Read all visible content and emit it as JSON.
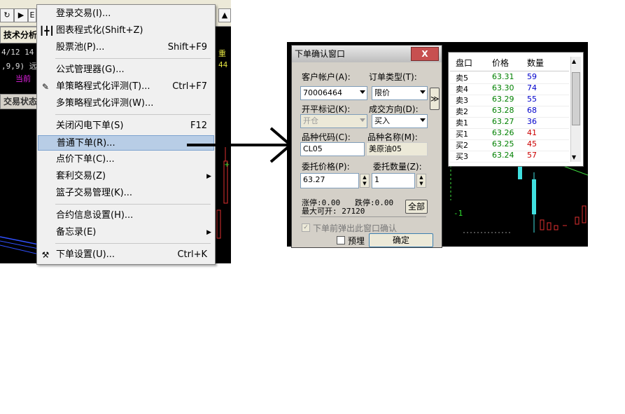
{
  "left": {
    "tab_label": "技术分析",
    "line1": "4/12 14",
    "line2": ",9,9) 远",
    "line3": "当前",
    "trade_tab": "交易状态",
    "right_text1": "重",
    "right_text2": "44"
  },
  "menu": {
    "items": [
      {
        "label": "登录交易(I)...",
        "shortcut": "",
        "icon": ""
      },
      {
        "label": "图表程式化(Shift+Z)",
        "shortcut": "",
        "icon": "candlestick"
      },
      {
        "label": "股票池(P)...",
        "shortcut": "Shift+F9",
        "icon": ""
      },
      {
        "label": "公式管理器(G)...",
        "shortcut": "",
        "icon": ""
      },
      {
        "label": "单策略程式化评测(T)...",
        "shortcut": "Ctrl+F7",
        "icon": "edit"
      },
      {
        "label": "多策略程式化评测(W)...",
        "shortcut": "",
        "icon": ""
      },
      {
        "label": "关闭闪电下单(S)",
        "shortcut": "F12",
        "icon": ""
      },
      {
        "label": "普通下单(R)...",
        "shortcut": "",
        "icon": ""
      },
      {
        "label": "点价下单(C)...",
        "shortcut": "",
        "icon": ""
      },
      {
        "label": "套利交易(Z)",
        "shortcut": "",
        "icon": ""
      },
      {
        "label": "篮子交易管理(K)...",
        "shortcut": "",
        "icon": ""
      },
      {
        "label": "合约信息设置(H)...",
        "shortcut": "",
        "icon": ""
      },
      {
        "label": "备忘录(E)",
        "shortcut": "",
        "icon": ""
      },
      {
        "label": "下单设置(U)...",
        "shortcut": "Ctrl+K",
        "icon": "tools"
      }
    ]
  },
  "dialog": {
    "title": "下单确认窗口",
    "close_label": "X",
    "account_label": "客户帐户(A):",
    "account_value": "70006464",
    "order_type_label": "订单类型(T):",
    "order_type_value": "限价",
    "open_close_label": "开平标记(K):",
    "open_close_value": "开仓",
    "direction_label": "成交方向(D):",
    "direction_value": "买入",
    "code_label": "品种代码(C):",
    "code_value": "CL05",
    "name_label": "品种名称(M):",
    "name_value": "美原油05",
    "price_label": "委托价格(P):",
    "price_value": "63.27",
    "qty_label": "委托数量(Z):",
    "qty_value": "1",
    "limit_up": "涨停:0.00",
    "limit_down": "跌停:0.00",
    "max_open": "最大可开: 27120",
    "all_button": "全部",
    "confirm_popup": "下单前弹出此窗口确认",
    "preview_label": "预埋",
    "ok_button": "确定",
    "expand_button": "≫"
  },
  "book": {
    "headers": [
      "盘口",
      "价格",
      "数量"
    ],
    "rows": [
      {
        "side": "卖5",
        "price": "63.31",
        "qty": "59"
      },
      {
        "side": "卖4",
        "price": "63.30",
        "qty": "74"
      },
      {
        "side": "卖3",
        "price": "63.29",
        "qty": "55"
      },
      {
        "side": "卖2",
        "price": "63.28",
        "qty": "68"
      },
      {
        "side": "卖1",
        "price": "63.27",
        "qty": "36"
      },
      {
        "side": "买1",
        "price": "63.26",
        "qty": "41"
      },
      {
        "side": "买2",
        "price": "63.25",
        "qty": "45"
      },
      {
        "side": "买3",
        "price": "63.24",
        "qty": "57"
      }
    ]
  },
  "chart_right": {
    "label": "-1"
  },
  "colors": {
    "price": "#008000",
    "ask_qty": "#0000cc",
    "bid_qty": "#cc0000",
    "candle_up": "#e03030",
    "candle_flat": "#40e0e0"
  }
}
